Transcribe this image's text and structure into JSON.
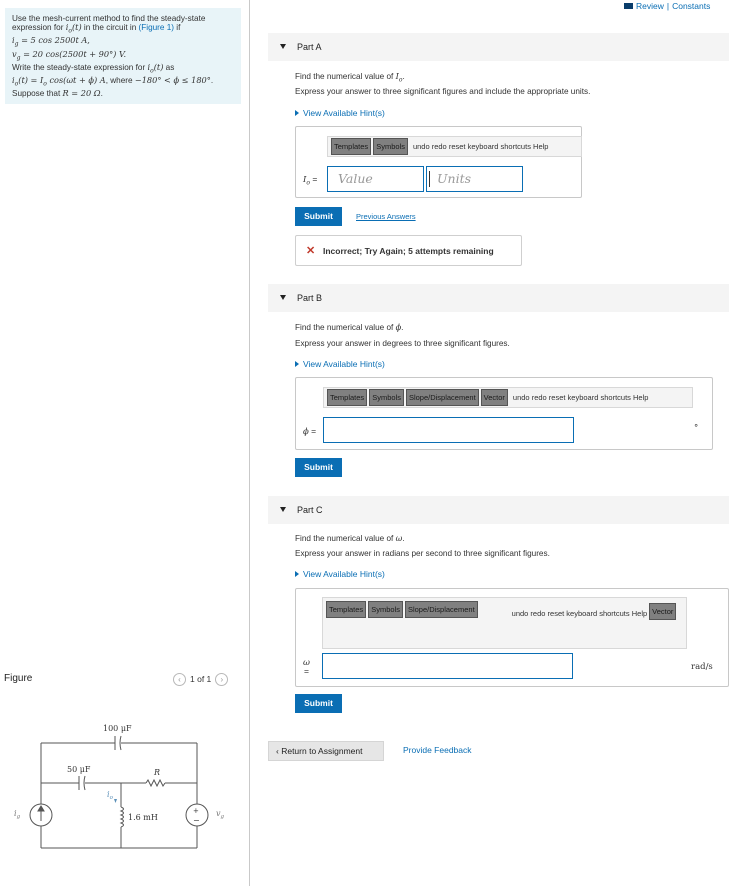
{
  "header": {
    "review_link": "Review",
    "separator": "|",
    "constants_link": "Constants"
  },
  "problem": {
    "line1": "Use the mesh-current method to find the steady-state",
    "line2_pre": "expression for ",
    "line2_var": "i",
    "line2_sub": "o",
    "line2_post": "(t)",
    "line2_mid": " in the circuit in ",
    "line2_link": "(Figure 1)",
    "line2_end": " if",
    "line3": "i",
    "line3_sub": "g",
    "line3_rest": " = 5 cos 2500t A,",
    "line4": "v",
    "line4_sub": "g",
    "line4_rest": " = 20 cos(2500t + 90°) V.",
    "line5_pre": "Write the steady-state expression for ",
    "line5_var": "i",
    "line5_sub": "o",
    "line5_post": "(t)",
    "line5_end": " as",
    "line6_a": "i",
    "line6_a_sub": "o",
    "line6_b": "(t) = I",
    "line6_b_sub": "o",
    "line6_c": " cos(ωt + ϕ) A",
    "line6_d": ", where ",
    "line6_e": "−180° < ϕ ≤ 180°",
    "line6_f": ".",
    "line7_pre": "Suppose that ",
    "line7_math": "R = 20 Ω",
    "line7_end": "."
  },
  "figure": {
    "label": "Figure",
    "pager_text": "1 of 1",
    "prev_icon": "chevron-left-icon",
    "next_icon": "chevron-right-icon",
    "c1": "100 μF",
    "c2": "50 μF",
    "r": "R",
    "l": "1.6 mH",
    "ig": "i",
    "ig_sub": "g",
    "io": "i",
    "io_sub": "o",
    "vg": "v",
    "vg_sub": "g",
    "plus": "+",
    "minus": "−"
  },
  "parts": [
    {
      "title": "Part A",
      "prompt_pre": "Find the numerical value of ",
      "prompt_var": "I",
      "prompt_sub": "o",
      "prompt_end": ".",
      "instruction": "Express your answer to three significant figures and include the appropriate units.",
      "hint": "View Available Hint(s)",
      "toolbar": [
        "Templates",
        "Symbols"
      ],
      "actions": "undo   redo   reset   keyboard shortcuts   Help",
      "var_label": "I",
      "var_sub": "o",
      "eq": " =",
      "value_placeholder": "Value",
      "units_placeholder": "Units",
      "submit": "Submit",
      "previous": "Previous Answers",
      "feedback": "Incorrect; Try Again; 5 attempts remaining"
    },
    {
      "title": "Part B",
      "prompt_pre": "Find the numerical value of ",
      "prompt_var": "ϕ",
      "prompt_end": ".",
      "instruction": "Express your answer in degrees to three significant figures.",
      "hint": "View Available Hint(s)",
      "toolbar": [
        "Templates",
        "Symbols",
        "Slope/Displacement",
        "Vector"
      ],
      "actions": "undo   redo   reset   keyboard shortcuts   Help",
      "var_label": "ϕ",
      "eq": " =",
      "unit": "°",
      "submit": "Submit"
    },
    {
      "title": "Part C",
      "prompt_pre": "Find the numerical value of ",
      "prompt_var": "ω",
      "prompt_end": ".",
      "instruction": "Express your answer in radians per second to three significant figures.",
      "hint": "View Available Hint(s)",
      "toolbar": [
        "Templates",
        "Symbols",
        "Slope/Displacement"
      ],
      "toolbar2": [
        "Vector"
      ],
      "actions": "undo   redo   reset   keyboard shortcuts   Help",
      "var_label": "ω",
      "eq": "=",
      "unit": "rad/s",
      "submit": "Submit"
    }
  ],
  "footer": {
    "return": "Return to Assignment",
    "provide": "Provide Feedback"
  },
  "colors": {
    "accent": "#0a6eb4",
    "panel": "#e8f4f8",
    "error": "#c0392b"
  }
}
